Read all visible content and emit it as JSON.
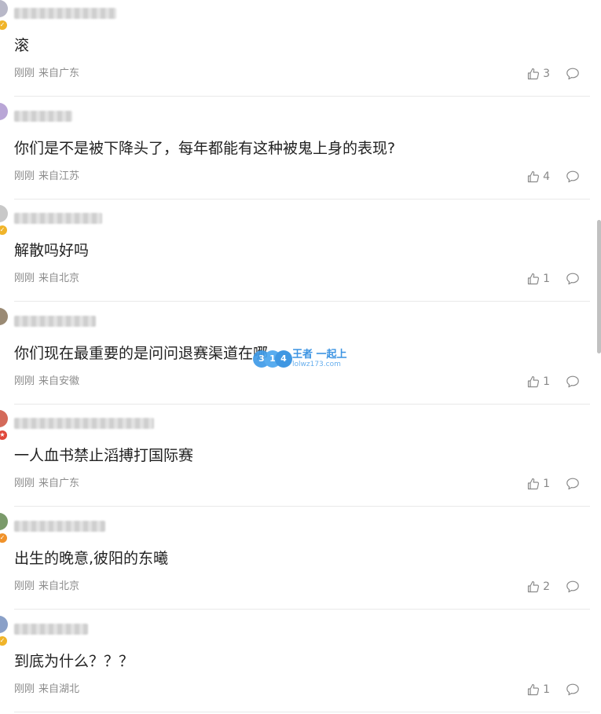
{
  "comments": [
    {
      "username": "******",
      "content": "滚",
      "time": "刚刚",
      "location": "来自广东",
      "likes": "3",
      "avatar_color": "#b8b8c8",
      "badge_color": "#f0b429",
      "badge_icon": "checkmark-badge"
    },
    {
      "username": "******",
      "content": "你们是不是被下降头了，每年都能有这种被鬼上身的表现?",
      "time": "刚刚",
      "location": "来自江苏",
      "likes": "4",
      "avatar_color": "#b9a6d6",
      "badge_color": "",
      "badge_icon": ""
    },
    {
      "username": "******",
      "content": "解散吗好吗",
      "time": "刚刚",
      "location": "来自北京",
      "likes": "1",
      "avatar_color": "#c8c8c8",
      "badge_color": "#f0b429",
      "badge_icon": "checkmark-badge"
    },
    {
      "username": "******",
      "content": "你们现在最重要的是问问退赛渠道在哪",
      "time": "刚刚",
      "location": "来自安徽",
      "likes": "1",
      "avatar_color": "#9a8a74",
      "badge_color": "",
      "badge_icon": ""
    },
    {
      "username": "******",
      "content": "一人血书禁止滔搏打国际赛",
      "time": "刚刚",
      "location": "来自广东",
      "likes": "1",
      "avatar_color": "#d46a5a",
      "badge_color": "#e0473a",
      "badge_icon": "vip-badge"
    },
    {
      "username": "******",
      "content": "出生的晚意,彼阳的东曦",
      "time": "刚刚",
      "location": "来自北京",
      "likes": "2",
      "avatar_color": "#7a9a6a",
      "badge_color": "#f0922a",
      "badge_icon": "checkmark-badge"
    },
    {
      "username": "******",
      "content": "到底为什么？？？",
      "time": "刚刚",
      "location": "来自湖北",
      "likes": "1",
      "avatar_color": "#8aa0c8",
      "badge_color": "#f0b429",
      "badge_icon": "checkmark-badge"
    }
  ],
  "icons": {
    "like": "thumbs-up-icon",
    "reply": "comment-bubble-icon"
  },
  "watermark": {
    "title": "王者 一起上",
    "url": "lolwz173.com"
  }
}
